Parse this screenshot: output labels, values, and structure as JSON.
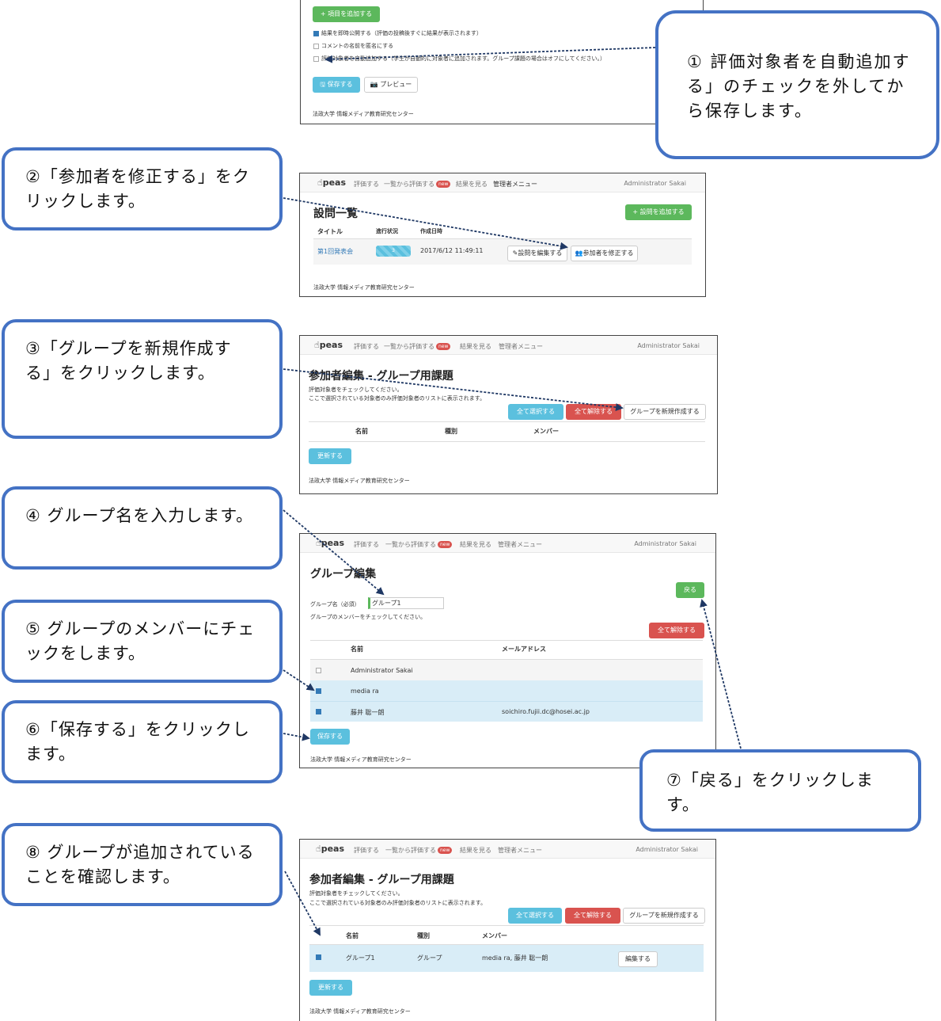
{
  "panel1": {
    "add_item_button": "+ 項目を追加する",
    "checkbox1": "結果を即時公開する（評価の投稿後すぐに結果が表示されます）",
    "checkbox2": "コメントの名前を匿名にする",
    "checkbox3": "評価対象者を自動追加する（学生が自動的に対象者に追加されます。グループ課題の場合はオフにしてください。）",
    "save_button": "保存する",
    "preview_button": "プレビュー",
    "footer": "法政大学 情報メディア教育研究センター"
  },
  "nav": {
    "logo": "peas",
    "items": [
      "評価する",
      "一覧から評価する",
      "結果を見る",
      "管理者メニュー"
    ],
    "new_badge": "new",
    "user": "Administrator Sakai"
  },
  "panel2": {
    "title": "設問一覧",
    "add_question_button": "+ 設問を追加する",
    "headers": [
      "タイトル",
      "進行状況",
      "作成日時"
    ],
    "row": {
      "title": "第1回発表会",
      "progress": "3",
      "date": "2017/6/12 11:49:11"
    },
    "edit_question_button": "設問を編集する",
    "edit_participants_button": "参加者を修正する",
    "footer": "法政大学 情報メディア教育研究センター"
  },
  "panel3": {
    "title": "参加者編集 - グループ用課題",
    "desc1": "評価対象者をチェックしてください。",
    "desc2": "ここで選択されている対象者のみ評価対象者のリストに表示されます。",
    "select_all_button": "全て選択する",
    "deselect_all_button": "全て解除する",
    "new_group_button": "グループを新規作成する",
    "headers": [
      "名前",
      "種別",
      "メンバー"
    ],
    "update_button": "更新する",
    "footer": "法政大学 情報メディア教育研究センター"
  },
  "panel4": {
    "title": "グループ編集",
    "back_button": "戻る",
    "group_name_label": "グループ名（必須）",
    "group_name_value": "グループ1",
    "member_hint": "グループのメンバーをチェックしてください。",
    "deselect_all_button": "全て解除する",
    "headers": [
      "名前",
      "メールアドレス"
    ],
    "rows": [
      {
        "name": "Administrator Sakai",
        "email": "",
        "checked": false
      },
      {
        "name": "media ra",
        "email": "",
        "checked": true
      },
      {
        "name": "藤井 聡一朗",
        "email": "soichiro.fujii.dc@hosei.ac.jp",
        "checked": true
      }
    ],
    "save_button": "保存する",
    "footer": "法政大学 情報メディア教育研究センター"
  },
  "panel5": {
    "title": "参加者編集 - グループ用課題",
    "desc1": "評価対象者をチェックしてください。",
    "desc2": "ここで選択されている対象者のみ評価対象者のリストに表示されます。",
    "select_all_button": "全て選択する",
    "deselect_all_button": "全て解除する",
    "new_group_button": "グループを新規作成する",
    "headers": [
      "名前",
      "種別",
      "メンバー"
    ],
    "row": {
      "name": "グループ1",
      "type": "グループ",
      "members": "media ra, 藤井 聡一朗"
    },
    "edit_button": "編集する",
    "update_button": "更新する",
    "footer": "法政大学 情報メディア教育研究センター"
  },
  "callouts": {
    "c1": "① 評価対象者を自動追加する」のチェックを外してから保存します。",
    "c2": "②「参加者を修正する」をクリックします。",
    "c3": "③「グループを新規作成する」をクリックします。",
    "c4": "④ グループ名を入力します。",
    "c5": "⑤ グループのメンバーにチェックをします。",
    "c6": "⑥「保存する」をクリックします。",
    "c7": "⑦「戻る」をクリックします。",
    "c8": "⑧ グループが追加されていることを確認します。"
  },
  "colors": {
    "callout_border": "#4472C4",
    "arrow": "#1F3864",
    "green": "#5cb85c",
    "blue": "#5bc0de",
    "red": "#d9534f",
    "highlight": "#d9edf7"
  }
}
